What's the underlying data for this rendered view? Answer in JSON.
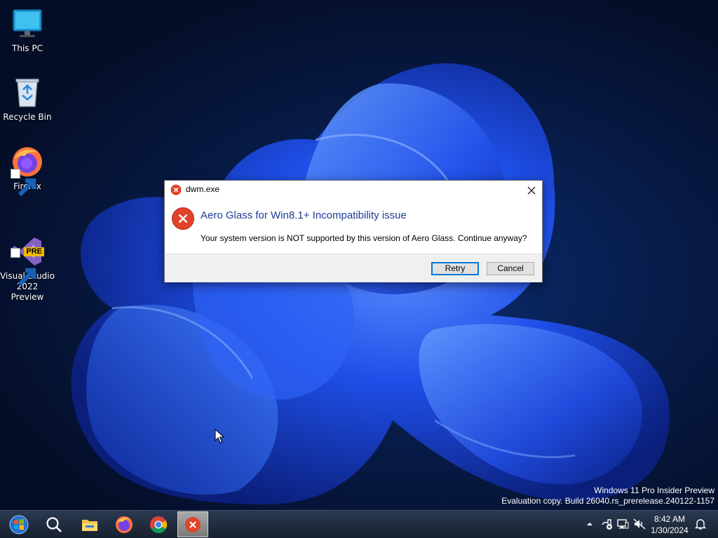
{
  "desktop": {
    "icons": [
      {
        "label": "This PC",
        "icon": "monitor-icon"
      },
      {
        "label": "Recycle Bin",
        "icon": "recycle-bin-icon"
      },
      {
        "label": "Firefox",
        "icon": "firefox-icon",
        "shortcut": true
      },
      {
        "label": "Visual Studio\n2022 Preview",
        "icon": "visual-studio-icon",
        "shortcut": true,
        "badge": "PRE"
      }
    ]
  },
  "dialog": {
    "title": "dwm.exe",
    "main_instruction": "Aero Glass for Win8.1+ Incompatibility issue",
    "content": "Your system version is NOT supported by this version of Aero Glass. Continue anyway?",
    "buttons": {
      "retry": "Retry",
      "cancel": "Cancel"
    },
    "icon": "error-icon",
    "colors": {
      "instruction": "#1e3c96",
      "error": "#e0432a"
    }
  },
  "watermark": {
    "line1": "Windows 11 Pro Insider Preview",
    "line2": "Evaluation copy. Build 26040.rs_prerelease.240122-1157"
  },
  "taskbar": {
    "buttons": [
      "start-orb-icon",
      "search-icon",
      "file-explorer-icon",
      "firefox-icon",
      "chrome-icon",
      "error-app-icon"
    ],
    "active_button": "error-app-icon",
    "tray": [
      "show-hidden-icons-chevron",
      "action-center-flag-icon",
      "network-icon",
      "volume-muted-icon",
      "notifications-bell-icon"
    ],
    "time": "8:42 AM",
    "date": "1/30/2024"
  }
}
